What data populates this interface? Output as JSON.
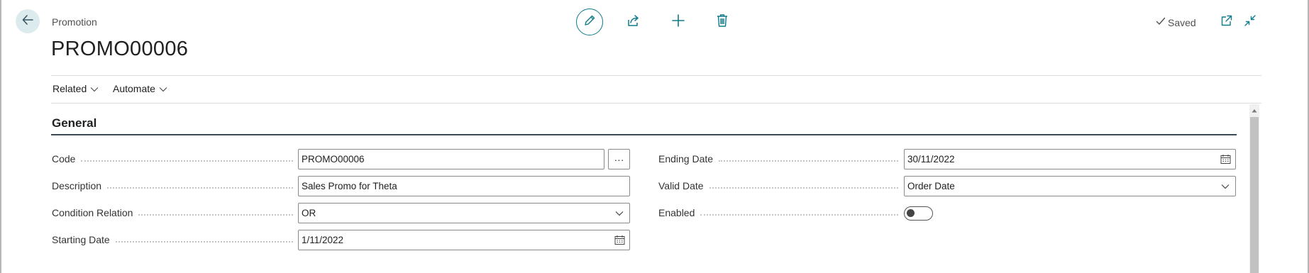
{
  "header": {
    "caption": "Promotion",
    "record_title": "PROMO00006",
    "status": "Saved"
  },
  "icons": {
    "back": "arrow-left-icon",
    "edit": "pencil-icon",
    "share": "share-icon",
    "new": "plus-icon",
    "delete": "trash-icon",
    "saved": "checkmark-icon",
    "open_new_window": "open-in-new-window-icon",
    "collapse": "collapse-icon",
    "calendar": "calendar-icon",
    "dropdown": "chevron-down-icon"
  },
  "colors": {
    "accent": "#0f7b8a",
    "back_button_bg": "#dcebee",
    "section_rule": "#3c4a57"
  },
  "menu": {
    "related": "Related",
    "automate": "Automate"
  },
  "section": {
    "title": "General"
  },
  "fields": {
    "code": {
      "label": "Code",
      "value": "PROMO00006",
      "assist_label": "···"
    },
    "description": {
      "label": "Description",
      "value": "Sales Promo for Theta"
    },
    "condition_relation": {
      "label": "Condition Relation",
      "value": "OR"
    },
    "starting_date": {
      "label": "Starting Date",
      "value": "1/11/2022"
    },
    "ending_date": {
      "label": "Ending Date",
      "value": "30/11/2022"
    },
    "valid_date": {
      "label": "Valid Date",
      "value": "Order Date"
    },
    "enabled": {
      "label": "Enabled",
      "value": false
    }
  }
}
